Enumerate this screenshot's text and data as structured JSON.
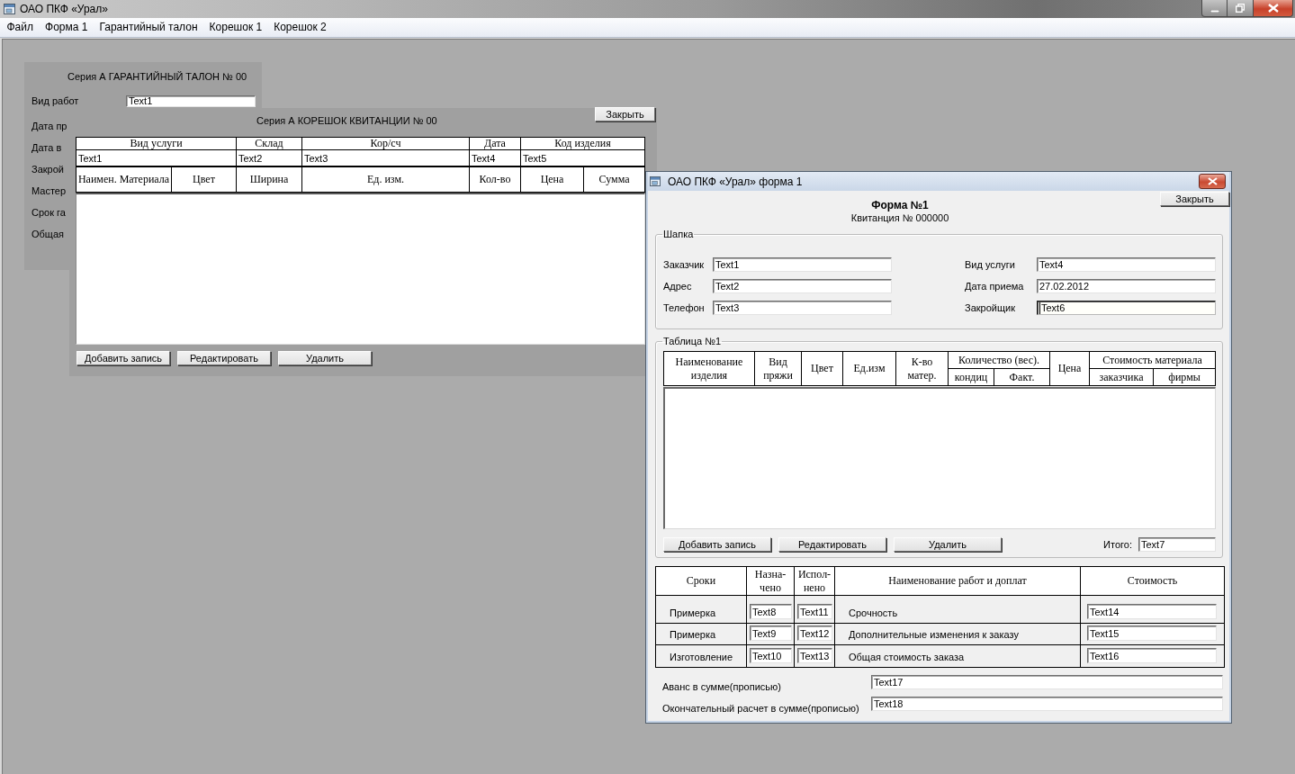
{
  "window": {
    "title": "ОАО ПКФ «Урал»"
  },
  "menu": [
    "Файл",
    "Форма 1",
    "Гарантийный талон",
    "Корешок 1",
    "Корешок 2"
  ],
  "warranty_window": {
    "title": "Серия А ГАРАНТИЙНЫЙ ТАЛОН № 00",
    "fields": [
      {
        "label": "Вид работ",
        "value": "Text1"
      },
      {
        "label": "Дата пр"
      },
      {
        "label": "Дата в"
      },
      {
        "label": "Закрой"
      },
      {
        "label": "Мастер"
      },
      {
        "label": "Срок га"
      },
      {
        "label": "Общая"
      }
    ]
  },
  "stub_window": {
    "title": "Серия А КОРЕШОК КВИТАНЦИИ № 00",
    "close_button": "Закрыть",
    "header_fields": [
      {
        "label": "Вид услуги",
        "value": "Text1"
      },
      {
        "label": "Склад",
        "value": "Text2"
      },
      {
        "label": "Кор/сч",
        "value": "Text3"
      },
      {
        "label": "Дата",
        "value": "Text4"
      },
      {
        "label": "Код изделия",
        "value": "Text5"
      }
    ],
    "table": {
      "columns": [
        "Наимен. Материала",
        "Цвет",
        "Ширина",
        "Ед. изм.",
        "Кол-во",
        "Цена",
        "Сумма"
      ]
    },
    "buttons": [
      "Добавить запись",
      "Редактировать",
      "Удалить"
    ]
  },
  "form_window": {
    "title": "ОАО ПКФ «Урал» форма 1",
    "close_button": "Закрыть",
    "heading": "Форма №1",
    "subheading": "Квитанция № 000000",
    "header_group": {
      "legend": "Шапка",
      "left_fields": [
        {
          "label": "Заказчик",
          "value": "Text1",
          "focused": false
        },
        {
          "label": "Адрес",
          "value": "Text2",
          "focused": false
        },
        {
          "label": "Телефон",
          "value": "Text3",
          "focused": false
        }
      ],
      "right_fields": [
        {
          "label": "Вид услуги",
          "value": "Text4",
          "focused": false
        },
        {
          "label": "Дата приема",
          "value": "27.02.2012",
          "focused": false
        },
        {
          "label": "Закройщик",
          "value": "Text6",
          "focused": true
        }
      ]
    },
    "table_group": {
      "legend": "Таблица №1",
      "columns": [
        {
          "label": "Наименование\nизделия"
        },
        {
          "label": "Вид\nпряжи"
        },
        {
          "label": "Цвет"
        },
        {
          "label": "Ед.изм"
        },
        {
          "label": "К-во\nматер."
        },
        {
          "label": "Количество (вес).",
          "children": [
            {
              "label": "кондиц"
            },
            {
              "label": "Факт."
            }
          ]
        },
        {
          "label": "Цена"
        },
        {
          "label": "Стоимость материала",
          "children": [
            {
              "label": "заказчика"
            },
            {
              "label": "фирмы"
            }
          ]
        }
      ],
      "buttons": [
        "Добавить запись",
        "Редактировать",
        "Удалить"
      ],
      "total": {
        "label": "Итого:",
        "value": "Text7"
      }
    },
    "terms_table": {
      "columns": [
        "Сроки",
        "Назна-\nчено",
        "Испол-\nнено",
        "Наименование работ и доплат",
        "Стоимость"
      ],
      "rows": [
        {
          "term": "Примерка",
          "assigned": "Text8",
          "done": "Text11",
          "work": "Срочность",
          "cost": "Text14"
        },
        {
          "term": "Примерка",
          "assigned": "Text9",
          "done": "Text12",
          "work": "Дополнительные изменения к заказу",
          "cost": "Text15"
        },
        {
          "term": "Изготовление",
          "assigned": "Text10",
          "done": "Text13",
          "work": "Общая стоимость заказа",
          "cost": "Text16"
        }
      ]
    },
    "payments": [
      {
        "label": "Аванс в сумме(прописью)",
        "value": "Text17"
      },
      {
        "label": "Окончательный расчет в сумме(прописью)",
        "value": "Text18"
      }
    ]
  }
}
